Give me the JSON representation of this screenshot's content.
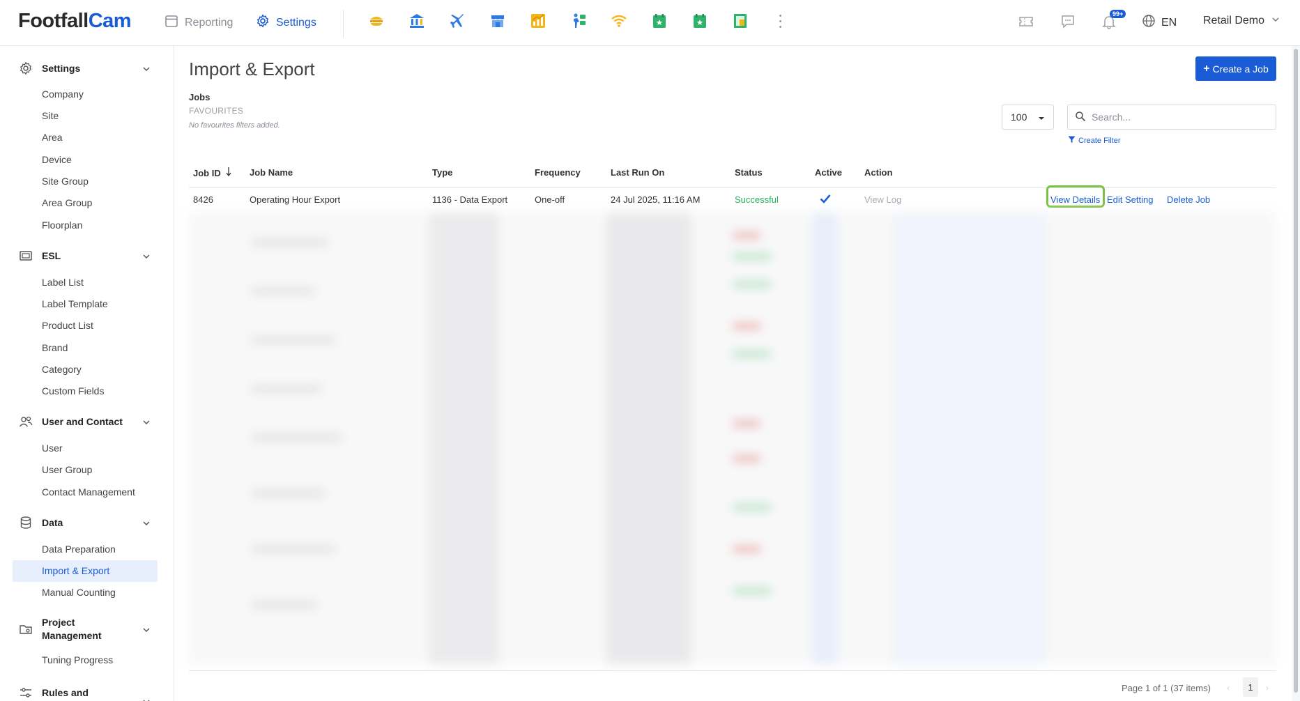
{
  "brand": {
    "name_part1": "Footfall",
    "name_part2": "Cam"
  },
  "topnav": {
    "reporting": "Reporting",
    "settings": "Settings"
  },
  "module_icons": [
    "store-icon",
    "bank-icon",
    "airport-icon",
    "shop-icon",
    "chart-icon",
    "people-counting-icon",
    "wifi-icon",
    "calendar-star-icon",
    "calendar-event-icon",
    "sheet-icon"
  ],
  "header_right": {
    "notifications_badge": "99+",
    "language": "EN",
    "account": "Retail Demo"
  },
  "sidebar": {
    "sections": [
      {
        "title": "Settings",
        "items": [
          "Company",
          "Site",
          "Area",
          "Device",
          "Site Group",
          "Area Group",
          "Floorplan"
        ]
      },
      {
        "title": "ESL",
        "items": [
          "Label List",
          "Label Template",
          "Product List",
          "Brand",
          "Category",
          "Custom Fields"
        ]
      },
      {
        "title": "User and Contact",
        "items": [
          "User",
          "User Group",
          "Contact Management"
        ]
      },
      {
        "title": "Data",
        "items": [
          "Data Preparation",
          "Import & Export",
          "Manual Counting"
        ]
      },
      {
        "title": "Project Management",
        "items": [
          "Tuning Progress"
        ]
      },
      {
        "title": "Rules and",
        "items": []
      }
    ],
    "active_item": "Import & Export"
  },
  "page": {
    "title": "Import & Export",
    "create_button": "Create a Job",
    "jobs_label": "Jobs",
    "favourites_label": "FAVOURITES",
    "favourites_empty": "No favourites filters added.",
    "page_size": "100",
    "search_placeholder": "Search...",
    "create_filter": "Create Filter"
  },
  "table": {
    "headers": [
      "Job ID",
      "Job Name",
      "Type",
      "Frequency",
      "Last Run On",
      "Status",
      "Active",
      "Action"
    ],
    "rows": [
      {
        "job_id": "8426",
        "job_name": "Operating Hour Export",
        "type": "1136 - Data Export",
        "frequency": "One-off",
        "last_run_on": "24 Jul 2025, 11:16 AM",
        "status": "Successful",
        "active": true,
        "actions": {
          "view_log": "View Log",
          "view_details": "View Details",
          "edit_setting": "Edit Setting",
          "delete_job": "Delete Job"
        }
      }
    ]
  },
  "pagination": {
    "info": "Page 1 of 1 (37 items)",
    "current_page": "1"
  },
  "colors": {
    "accent": "#1a5bd6",
    "success": "#20b25a",
    "highlight": "#7cc142"
  }
}
